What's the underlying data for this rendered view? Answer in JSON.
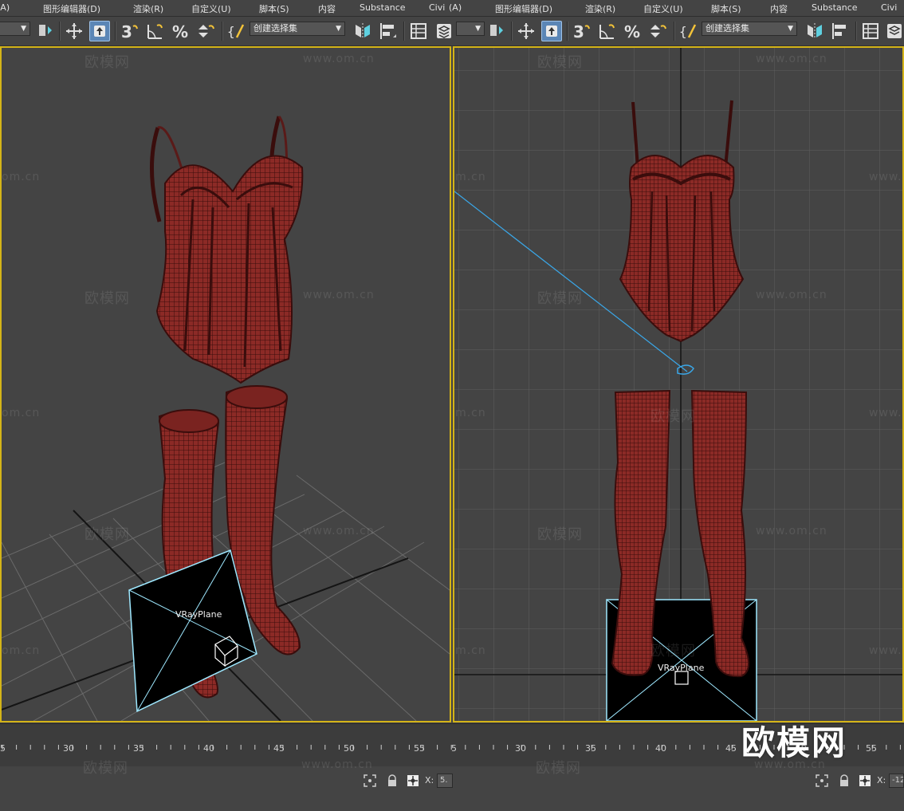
{
  "menubar": {
    "items": [
      "(A)",
      "图形编辑器(D)",
      "渲染(R)",
      "自定义(U)",
      "脚本(S)",
      "内容",
      "Substance",
      "Civi",
      "(A)",
      "图形编辑器(D)",
      "渲染(R)",
      "自定义(U)",
      "脚本(S)",
      "内容",
      "Substance",
      "Civi"
    ]
  },
  "toolbar": {
    "selection_set_placeholder": "创建选择集",
    "selection_set_placeholder_2": "创建选择集"
  },
  "viewport_left": {
    "object_label": "VRayPlane"
  },
  "viewport_right": {
    "object_label": "VRayPlane"
  },
  "watermarks": {
    "logo_text": "欧模网",
    "url_text": "www.om.cn",
    "partial_url": "om.cn",
    "partial_url_2": "www.o"
  },
  "timeline": {
    "ticks_left": [
      "5",
      "30",
      "35",
      "40",
      "45",
      "50",
      "5"
    ],
    "ticks_right": [
      "30",
      "35",
      "40",
      "45",
      "50",
      "55"
    ]
  },
  "status": {
    "x_label": "X:",
    "x_value_left": "5.",
    "x_label_2": "X:",
    "x_value_right": "-12"
  },
  "brand": {
    "logo": "欧模网"
  },
  "colors": {
    "viewport_border": "#d4b417",
    "mesh_fill": "#8c2a26",
    "mesh_wire": "#3a0d0c",
    "plane_outline": "#9ee8ff",
    "active_button": "#5b86b6"
  }
}
